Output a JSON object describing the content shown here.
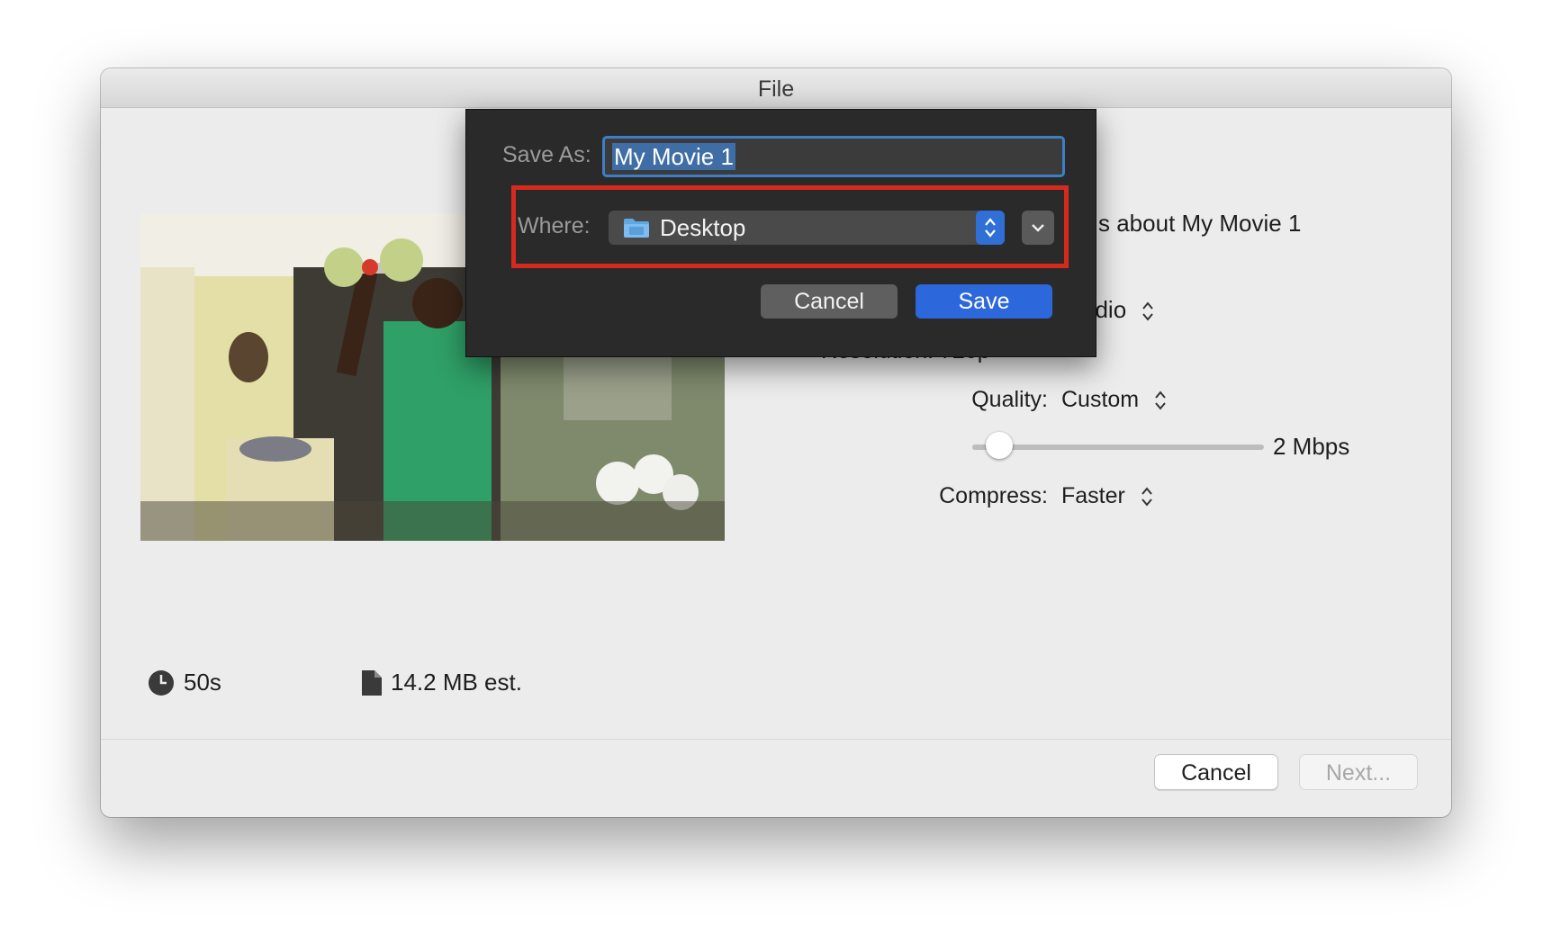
{
  "window": {
    "title": "File"
  },
  "settings": {
    "description_partial": "s about My Movie 1",
    "format_partial": "udio",
    "resolution_partial": "Resolution:  720p",
    "quality_label": "Quality:",
    "quality_value": "Custom",
    "bitrate": "2 Mbps",
    "bitrate_slider_fraction": 0.05,
    "compress_label": "Compress:",
    "compress_value": "Faster"
  },
  "stats": {
    "duration": "50s",
    "size": "14.2 MB est."
  },
  "buttons": {
    "cancel": "Cancel",
    "next": "Next..."
  },
  "save_sheet": {
    "save_as_label": "Save As:",
    "filename": "My Movie 1",
    "where_label": "Where:",
    "where_value": "Desktop",
    "cancel": "Cancel",
    "save": "Save"
  },
  "colors": {
    "accent": "#2c67dc",
    "highlight": "#d52b1e"
  }
}
